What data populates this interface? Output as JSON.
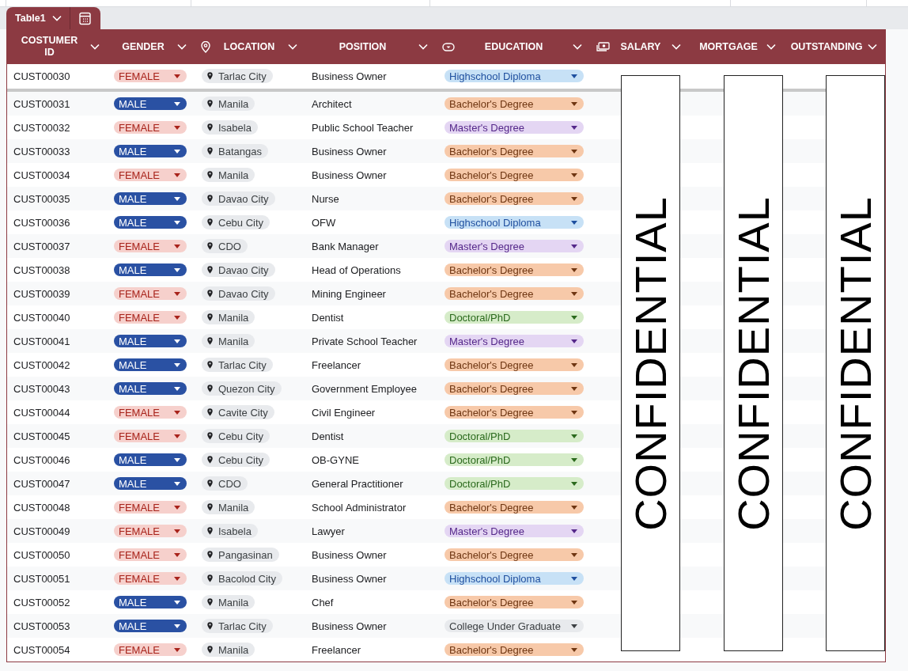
{
  "table_tab": {
    "label": "Table1"
  },
  "columns": [
    {
      "label": "COSTUMER ID",
      "kind": "text"
    },
    {
      "label": "GENDER",
      "kind": "dropdown"
    },
    {
      "label": "LOCATION",
      "kind": "place"
    },
    {
      "label": "POSITION",
      "kind": "text"
    },
    {
      "label": "EDUCATION",
      "kind": "chip"
    },
    {
      "label": "SALARY",
      "kind": "currency"
    },
    {
      "label": "MORTGAGE",
      "kind": "text"
    },
    {
      "label": "OUTSTANDING",
      "kind": "text"
    }
  ],
  "rows": [
    {
      "id": "CUST00030",
      "gender": {
        "label": "FEMALE",
        "color": "#f6d0cc"
      },
      "location": "Tarlac City",
      "position": "Business Owner",
      "education": {
        "label": "Highschool Diploma",
        "color": "#c7e1f6"
      }
    },
    {
      "id": "CUST00031",
      "gender": {
        "label": "MALE",
        "color": "#2a51a3"
      },
      "location": "Manila",
      "position": "Architect",
      "education": {
        "label": "Bachelor's Degree",
        "color": "#f7c9a9"
      }
    },
    {
      "id": "CUST00032",
      "gender": {
        "label": "FEMALE",
        "color": "#f6d0cc"
      },
      "location": "Isabela",
      "position": "Public School Teacher",
      "education": {
        "label": "Master's Degree",
        "color": "#e4d6f3"
      }
    },
    {
      "id": "CUST00033",
      "gender": {
        "label": "MALE",
        "color": "#2a51a3"
      },
      "location": "Batangas",
      "position": "Business Owner",
      "education": {
        "label": "Bachelor's Degree",
        "color": "#f7c9a9"
      }
    },
    {
      "id": "CUST00034",
      "gender": {
        "label": "FEMALE",
        "color": "#f6d0cc"
      },
      "location": "Manila",
      "position": "Business Owner",
      "education": {
        "label": "Bachelor's Degree",
        "color": "#f7c9a9"
      }
    },
    {
      "id": "CUST00035",
      "gender": {
        "label": "MALE",
        "color": "#2a51a3"
      },
      "location": "Davao City",
      "position": "Nurse",
      "education": {
        "label": "Bachelor's Degree",
        "color": "#f7c9a9"
      }
    },
    {
      "id": "CUST00036",
      "gender": {
        "label": "MALE",
        "color": "#2a51a3"
      },
      "location": "Cebu City",
      "position": "OFW",
      "education": {
        "label": "Highschool Diploma",
        "color": "#c7e1f6"
      }
    },
    {
      "id": "CUST00037",
      "gender": {
        "label": "FEMALE",
        "color": "#f6d0cc"
      },
      "location": "CDO",
      "position": "Bank Manager",
      "education": {
        "label": "Master's Degree",
        "color": "#e4d6f3"
      }
    },
    {
      "id": "CUST00038",
      "gender": {
        "label": "MALE",
        "color": "#2a51a3"
      },
      "location": "Davao City",
      "position": "Head of Operations",
      "education": {
        "label": "Bachelor's Degree",
        "color": "#f7c9a9"
      }
    },
    {
      "id": "CUST00039",
      "gender": {
        "label": "FEMALE",
        "color": "#f6d0cc"
      },
      "location": "Davao City",
      "position": "Mining Engineer",
      "education": {
        "label": "Bachelor's Degree",
        "color": "#f7c9a9"
      }
    },
    {
      "id": "CUST00040",
      "gender": {
        "label": "FEMALE",
        "color": "#f6d0cc"
      },
      "location": "Manila",
      "position": "Dentist",
      "education": {
        "label": "Doctoral/PhD",
        "color": "#d6ecc9"
      }
    },
    {
      "id": "CUST00041",
      "gender": {
        "label": "MALE",
        "color": "#2a51a3"
      },
      "location": "Manila",
      "position": "Private School Teacher",
      "education": {
        "label": "Master's Degree",
        "color": "#e4d6f3"
      }
    },
    {
      "id": "CUST00042",
      "gender": {
        "label": "MALE",
        "color": "#2a51a3"
      },
      "location": "Tarlac City",
      "position": "Freelancer",
      "education": {
        "label": "Bachelor's Degree",
        "color": "#f7c9a9"
      }
    },
    {
      "id": "CUST00043",
      "gender": {
        "label": "MALE",
        "color": "#2a51a3"
      },
      "location": "Quezon City",
      "position": "Government Employee",
      "education": {
        "label": "Bachelor's Degree",
        "color": "#f7c9a9"
      }
    },
    {
      "id": "CUST00044",
      "gender": {
        "label": "FEMALE",
        "color": "#f6d0cc"
      },
      "location": "Cavite City",
      "position": "Civil Engineer",
      "education": {
        "label": "Bachelor's Degree",
        "color": "#f7c9a9"
      }
    },
    {
      "id": "CUST00045",
      "gender": {
        "label": "FEMALE",
        "color": "#f6d0cc"
      },
      "location": "Cebu City",
      "position": "Dentist",
      "education": {
        "label": "Doctoral/PhD",
        "color": "#d6ecc9"
      }
    },
    {
      "id": "CUST00046",
      "gender": {
        "label": "MALE",
        "color": "#2a51a3"
      },
      "location": "Cebu City",
      "position": "OB-GYNE",
      "education": {
        "label": "Doctoral/PhD",
        "color": "#d6ecc9"
      }
    },
    {
      "id": "CUST00047",
      "gender": {
        "label": "MALE",
        "color": "#2a51a3"
      },
      "location": "CDO",
      "position": "General Practitioner",
      "education": {
        "label": "Doctoral/PhD",
        "color": "#d6ecc9"
      }
    },
    {
      "id": "CUST00048",
      "gender": {
        "label": "FEMALE",
        "color": "#f6d0cc"
      },
      "location": "Manila",
      "position": "School Administrator",
      "education": {
        "label": "Bachelor's Degree",
        "color": "#f7c9a9"
      }
    },
    {
      "id": "CUST00049",
      "gender": {
        "label": "FEMALE",
        "color": "#f6d0cc"
      },
      "location": "Isabela",
      "position": "Lawyer",
      "education": {
        "label": "Master's Degree",
        "color": "#e4d6f3"
      }
    },
    {
      "id": "CUST00050",
      "gender": {
        "label": "FEMALE",
        "color": "#f6d0cc"
      },
      "location": "Pangasinan",
      "position": "Business Owner",
      "education": {
        "label": "Bachelor's Degree",
        "color": "#f7c9a9"
      }
    },
    {
      "id": "CUST00051",
      "gender": {
        "label": "FEMALE",
        "color": "#f6d0cc"
      },
      "location": "Bacolod City",
      "position": "Business Owner",
      "education": {
        "label": "Highschool Diploma",
        "color": "#c7e1f6"
      }
    },
    {
      "id": "CUST00052",
      "gender": {
        "label": "MALE",
        "color": "#2a51a3"
      },
      "location": "Manila",
      "position": "Chef",
      "education": {
        "label": "Bachelor's Degree",
        "color": "#f7c9a9"
      }
    },
    {
      "id": "CUST00053",
      "gender": {
        "label": "MALE",
        "color": "#2a51a3"
      },
      "location": "Tarlac City",
      "position": "Business Owner",
      "education": {
        "label": "College Under Graduate",
        "color": "#e8eaed"
      }
    },
    {
      "id": "CUST00054",
      "gender": {
        "label": "FEMALE",
        "color": "#f6d0cc"
      },
      "location": "Manila",
      "position": "Freelancer",
      "education": {
        "label": "Bachelor's Degree",
        "color": "#f7c9a9"
      }
    }
  ],
  "redaction_labels": [
    "CONFIDENTIAL",
    "CONFIDENTIAL",
    "CONFIDENTIAL"
  ]
}
